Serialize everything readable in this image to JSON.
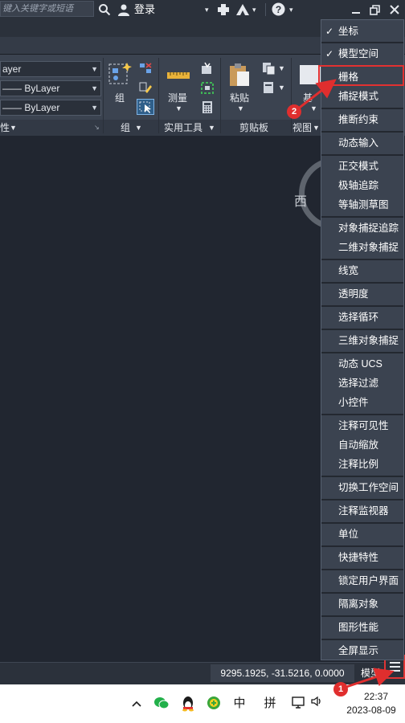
{
  "titlebar": {
    "search_placeholder": "键入关键字或短语",
    "login": "登录"
  },
  "ribbon": {
    "layer_value": "ayer",
    "color_value": "—— ByLayer",
    "linetype_value": "—— ByLayer",
    "properties_label": "性",
    "group_button": "组",
    "group_panel": "组",
    "measure_button": "测量",
    "utilities_panel": "实用工具",
    "paste_button": "粘贴",
    "clipboard_panel": "剪贴板",
    "base_button": "基",
    "view_panel": "视图"
  },
  "canvas": {
    "compass_west": "西"
  },
  "status_menu": {
    "items": [
      {
        "label": "坐标",
        "checked": true
      },
      {
        "label": "模型空间",
        "checked": true
      },
      {
        "label": "栅格",
        "checked": false
      },
      {
        "label": "捕捉模式",
        "checked": false
      },
      {
        "label": "推断约束",
        "checked": false
      },
      {
        "label": "动态输入",
        "checked": false
      },
      {
        "label": "正交模式",
        "checked": false
      },
      {
        "label": "极轴追踪",
        "checked": false
      },
      {
        "label": "等轴测草图",
        "checked": false
      },
      {
        "label": "对象捕捉追踪",
        "checked": false
      },
      {
        "label": "二维对象捕捉",
        "checked": false
      },
      {
        "label": "线宽",
        "checked": false
      },
      {
        "label": "透明度",
        "checked": false
      },
      {
        "label": "选择循环",
        "checked": false
      },
      {
        "label": "三维对象捕捉",
        "checked": false
      },
      {
        "label": "动态 UCS",
        "checked": false
      },
      {
        "label": "选择过滤",
        "checked": false
      },
      {
        "label": "小控件",
        "checked": false
      },
      {
        "label": "注释可见性",
        "checked": false
      },
      {
        "label": "自动缩放",
        "checked": false
      },
      {
        "label": "注释比例",
        "checked": false
      },
      {
        "label": "切换工作空间",
        "checked": false
      },
      {
        "label": "注释监视器",
        "checked": false
      },
      {
        "label": "单位",
        "checked": false
      },
      {
        "label": "快捷特性",
        "checked": false
      },
      {
        "label": "锁定用户界面",
        "checked": false
      },
      {
        "label": "隔离对象",
        "checked": false
      },
      {
        "label": "图形性能",
        "checked": false
      },
      {
        "label": "全屏显示",
        "checked": false
      }
    ],
    "check_glyph": "✓"
  },
  "statusbar": {
    "coordinates": "9295.1925, -31.5216, 0.0000",
    "model_button": "模型"
  },
  "taskbar": {
    "ime_lang": "中",
    "ime_mode": "拼",
    "time": "22:37",
    "date": "2023-08-09"
  },
  "annotations": {
    "step1": "1",
    "step2": "2"
  },
  "colors": {
    "annotation_red": "#e02e2e",
    "menu_bg": "#3b4350",
    "canvas_bg": "#212630"
  }
}
